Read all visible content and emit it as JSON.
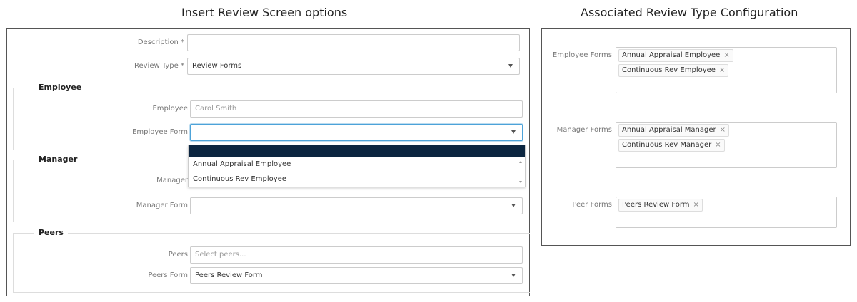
{
  "headings": {
    "left": "Insert Review Screen options",
    "right": "Associated Review Type Configuration"
  },
  "insert_form": {
    "description": {
      "label": "Description *",
      "value": ""
    },
    "review_type": {
      "label": "Review Type *",
      "value": "Review Forms"
    },
    "employee_section": {
      "legend": "Employee",
      "employee": {
        "label": "Employee",
        "value": "Carol Smith"
      },
      "employee_form": {
        "label": "Employee Form",
        "value": ""
      }
    },
    "manager_section": {
      "legend": "Manager",
      "manager": {
        "label": "Manager",
        "value": ""
      },
      "manager_form": {
        "label": "Manager Form",
        "value": ""
      }
    },
    "peers_section": {
      "legend": "Peers",
      "peers": {
        "label": "Peers",
        "placeholder": "Select peers..."
      },
      "peers_form": {
        "label": "Peers Form",
        "value": "Peers Review Form"
      }
    },
    "employee_form_dropdown": {
      "options": [
        "Annual Appraisal Employee",
        "Continuous Rev Employee"
      ]
    }
  },
  "review_type_config": {
    "employee_forms": {
      "label": "Employee Forms",
      "tags": [
        "Annual Appraisal Employee",
        "Continuous Rev Employee"
      ]
    },
    "manager_forms": {
      "label": "Manager Forms",
      "tags": [
        "Annual Appraisal Manager",
        "Continuous Rev Manager"
      ]
    },
    "peer_forms": {
      "label": "Peer Forms",
      "tags": [
        "Peers Review Form"
      ]
    },
    "remove_glyph": "×"
  },
  "colors": {
    "dropdown_highlight": "#0b2540",
    "focus_border": "#4da3d9"
  }
}
